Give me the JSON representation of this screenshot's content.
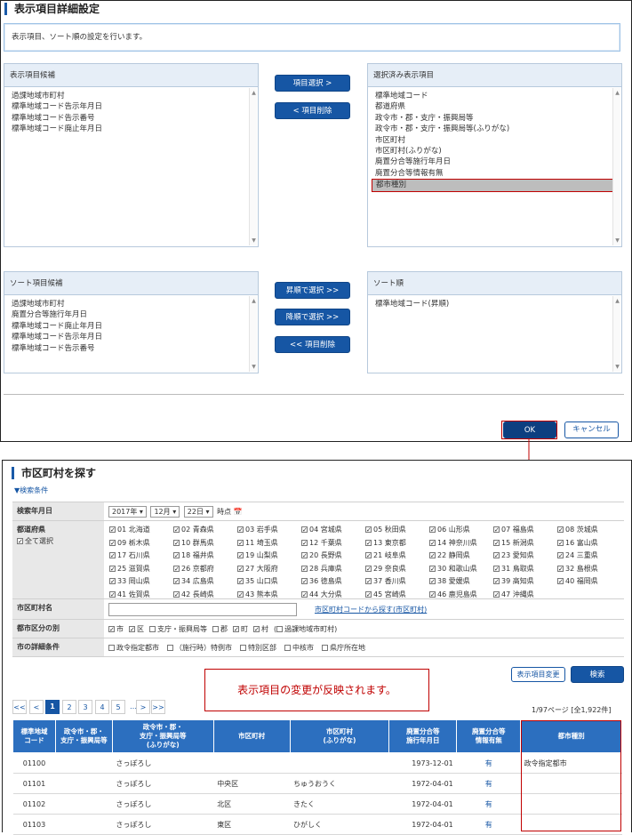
{
  "settings": {
    "title": "表示項目詳細設定",
    "info": "表示項目、ソート順の設定を行います。",
    "available_items": {
      "header": "表示項目候補",
      "items": [
        "過課地域市町村",
        "標準地域コード告示年月日",
        "標準地域コード告示番号",
        "標準地域コード廃止年月日"
      ]
    },
    "selected_items": {
      "header": "選択済み表示項目",
      "items": [
        "標準地域コード",
        "都道府県",
        "政令市・郡・支庁・振興局等",
        "政令市・郡・支庁・振興局等(ふりがな)",
        "市区町村",
        "市区町村(ふりがな)",
        "廃置分合等施行年月日",
        "廃置分合等情報有無",
        "都市種別"
      ]
    },
    "btn_select": "項目選択 >",
    "btn_remove": "< 項目削除",
    "sort_candidates": {
      "header": "ソート項目候補",
      "items": [
        "過課地域市町村",
        "廃置分合等施行年月日",
        "標準地域コード廃止年月日",
        "標準地域コード告示年月日",
        "標準地域コード告示番号"
      ]
    },
    "sort_order": {
      "header": "ソート順",
      "items": [
        "標準地域コード(昇順)"
      ]
    },
    "btn_asc": "昇順で選択 >>",
    "btn_desc": "降順で選択 >>",
    "btn_sort_remove": "<< 項目削除",
    "btn_ok": "OK",
    "btn_cancel": "キャンセル"
  },
  "search": {
    "title": "市区町村を探す",
    "conditions_toggle": "▼検索条件",
    "date_label": "検索年月日",
    "year": "2017年",
    "month": "12月",
    "day": "22日",
    "time_suffix": "時点",
    "pref_label": "都道府県",
    "select_all": "全て選択",
    "prefectures": [
      "01 北海道",
      "02 青森県",
      "03 岩手県",
      "04 宮城県",
      "05 秋田県",
      "06 山形県",
      "07 福島県",
      "08 茨城県",
      "09 栃木県",
      "10 群馬県",
      "11 埼玉県",
      "12 千葉県",
      "13 東京都",
      "14 神奈川県",
      "15 新潟県",
      "16 富山県",
      "17 石川県",
      "18 福井県",
      "19 山梨県",
      "20 長野県",
      "21 岐阜県",
      "22 静岡県",
      "23 愛知県",
      "24 三重県",
      "25 滋賀県",
      "26 京都府",
      "27 大阪府",
      "28 兵庫県",
      "29 奈良県",
      "30 和歌山県",
      "31 鳥取県",
      "32 島根県",
      "33 岡山県",
      "34 広島県",
      "35 山口県",
      "36 徳島県",
      "37 香川県",
      "38 愛媛県",
      "39 高知県",
      "40 福岡県",
      "41 佐賀県",
      "42 長崎県",
      "43 熊本県",
      "44 大分県",
      "45 宮崎県",
      "46 鹿児島県",
      "47 沖縄県"
    ],
    "name_label": "市区町村名",
    "name_value": "",
    "name_link": "市区町村コードから探す(市区町村)",
    "type_label": "都市区分の別",
    "types": [
      {
        "label": "市",
        "checked": true
      },
      {
        "label": "区",
        "checked": true
      },
      {
        "label": "支庁・振興局等",
        "checked": false
      },
      {
        "label": "郡",
        "checked": false
      },
      {
        "label": "町",
        "checked": true
      },
      {
        "label": "村",
        "checked": true
      }
    ],
    "type_extra": "過課地域市町村",
    "detail_label": "市の詳細条件",
    "details": [
      "政令指定都市",
      "（施行時）特例市",
      "特別区部",
      "中核市",
      "県庁所在地"
    ],
    "callout": "表示項目の変更が反映されます。",
    "btn_change": "表示項目変更",
    "btn_search": "検索",
    "pagination": [
      "<<",
      "<",
      "1",
      "2",
      "3",
      "4",
      "5",
      "…",
      ">",
      ">>"
    ],
    "page_info": "1/97ページ [全1,922件]",
    "columns": [
      "標準地域\nコード",
      "政令市・郡・\n支庁・振興局等",
      "政令市・郡・\n支庁・振興局等\n(ふりがな)",
      "市区町村",
      "市区町村\n(ふりがな)",
      "廃置分合等\n施行年月日",
      "廃置分合等\n情報有無",
      "都市種別"
    ],
    "rows": [
      [
        "01100",
        "",
        "さっぽろし",
        "",
        "",
        "1973-12-01",
        "有",
        "政令指定都市"
      ],
      [
        "01101",
        "",
        "さっぽろし",
        "中央区",
        "ちゅうおうく",
        "1972-04-01",
        "有",
        ""
      ],
      [
        "01102",
        "",
        "さっぽろし",
        "北区",
        "きたく",
        "1972-04-01",
        "有",
        ""
      ],
      [
        "01103",
        "",
        "さっぽろし",
        "東区",
        "ひがしく",
        "1972-04-01",
        "有",
        ""
      ]
    ]
  }
}
